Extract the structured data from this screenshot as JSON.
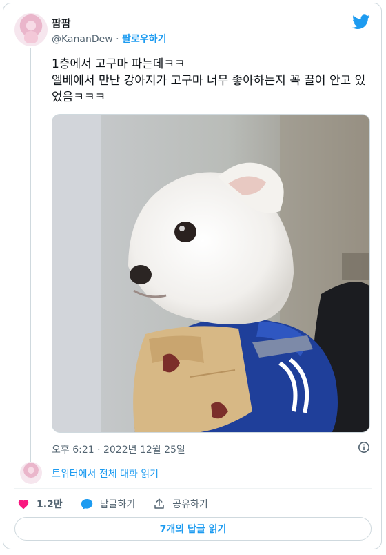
{
  "author": {
    "name": "팜팜",
    "handle": "@KananDew",
    "separator": "·",
    "follow_label": "팔로우하기"
  },
  "tweet": {
    "text": "1층에서 고구마 파는데ㅋㅋ\n엘베에서 만난 강아지가 고구마 너무 좋아하는지 꼭 끌어 안고 있었음ㅋㅋㅋ",
    "timestamp": "오후 6:21 · 2022년 12월 25일"
  },
  "conversation": {
    "read_label": "트위터에서 전체 대화 읽기"
  },
  "actions": {
    "like_count": "1.2만",
    "reply_label": "답글하기",
    "share_label": "공유하기"
  },
  "replies_button": {
    "label": "7개의 답글 읽기"
  },
  "colors": {
    "accent": "#1d9bf0",
    "like": "#f91880",
    "text": "#0f1419",
    "secondary": "#536471",
    "border": "#cfd9de"
  },
  "icons": [
    "twitter-bird-icon",
    "info-icon",
    "heart-icon",
    "comment-icon",
    "share-icon"
  ]
}
